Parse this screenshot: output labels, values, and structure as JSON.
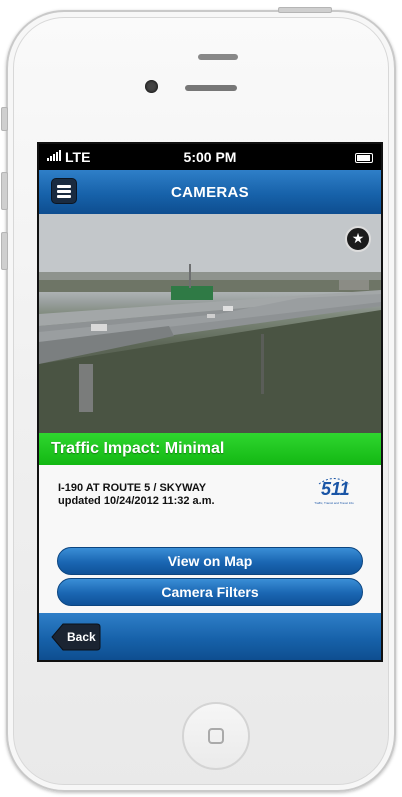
{
  "status_bar": {
    "carrier": "LTE",
    "time": "5:00 PM"
  },
  "header": {
    "title": "CAMERAS"
  },
  "camera": {
    "traffic_impact": "Traffic Impact: Minimal",
    "location": "I-190 AT ROUTE 5 / SKYWAY",
    "updated": "updated 10/24/2012 11:32 a.m."
  },
  "logo": {
    "number": "511",
    "subtitle": "Traffic, Transit and Travel Info"
  },
  "buttons": {
    "view_on_map": "View on Map",
    "camera_filters": "Camera Filters"
  },
  "toolbar": {
    "back_label": "Back"
  },
  "colors": {
    "nav_blue": "#1762aa",
    "impact_green": "#13b813"
  },
  "icons": {
    "menu": "hamburger-menu-icon",
    "favorite": "star-icon"
  }
}
